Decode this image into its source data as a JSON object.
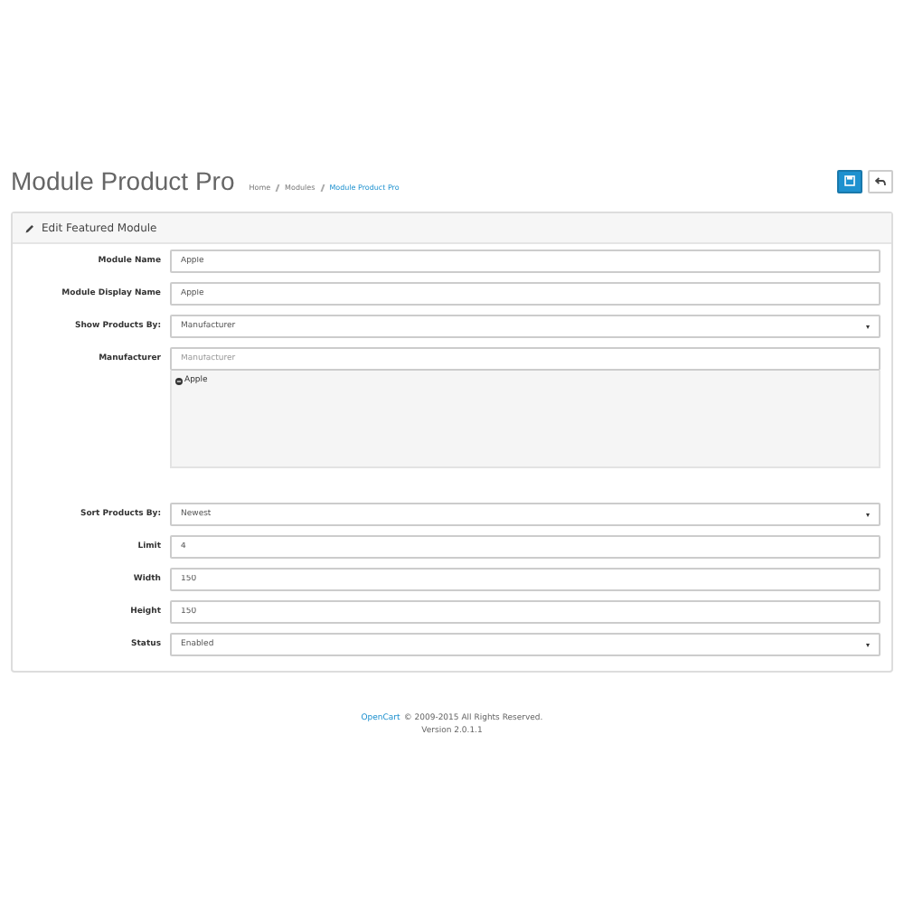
{
  "page_title": "Module Product Pro",
  "breadcrumb": [
    {
      "label": "Home"
    },
    {
      "label": "Modules"
    },
    {
      "label": "Module Product Pro"
    }
  ],
  "panel": {
    "title": "Edit Featured Module",
    "fields": [
      {
        "kind": "text",
        "label": "Module Name",
        "value": "Apple"
      },
      {
        "kind": "text",
        "label": "Module Display Name",
        "value": "Apple"
      },
      {
        "kind": "select",
        "label": "Show Products By:",
        "value": "Manufacturer"
      },
      {
        "kind": "autocomplete",
        "label": "Manufacturer",
        "placeholder": "Manufacturer",
        "items": [
          "Apple"
        ]
      },
      {
        "kind": "select",
        "label": "Sort Products By:",
        "value": "Newest"
      },
      {
        "kind": "text",
        "label": "Limit",
        "value": "4"
      },
      {
        "kind": "text",
        "label": "Width",
        "value": "150"
      },
      {
        "kind": "text",
        "label": "Height",
        "value": "150"
      },
      {
        "kind": "select",
        "label": "Status",
        "value": "Enabled"
      }
    ]
  },
  "footer": {
    "link": "OpenCart",
    "text": "© 2009-2015 All Rights Reserved.",
    "version": "Version 2.0.1.1"
  }
}
